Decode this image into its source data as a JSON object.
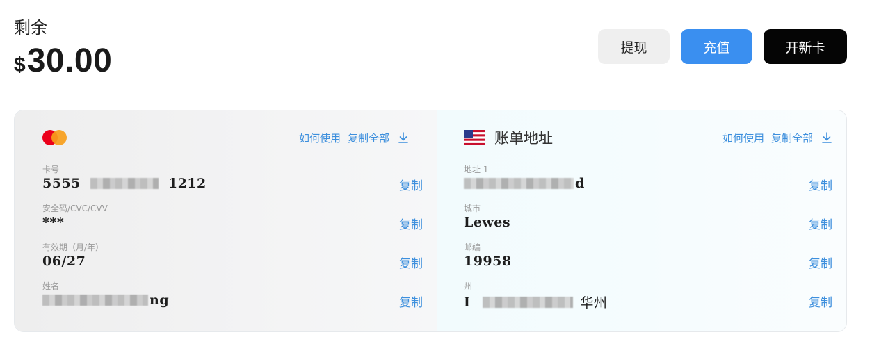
{
  "balance": {
    "label": "剩余",
    "currency": "$",
    "amount": "30.00"
  },
  "actions": {
    "withdraw": "提现",
    "topup": "充值",
    "new_card": "开新卡"
  },
  "card": {
    "brand_icon": "mastercard-logo",
    "how_to_use": "如何使用",
    "copy_all": "复制全部",
    "fields": {
      "number": {
        "label": "卡号",
        "prefix": "5555",
        "suffix": "1212",
        "copy": "复制"
      },
      "cvv": {
        "label": "安全码/CVC/CVV",
        "value": "***",
        "copy": "复制"
      },
      "expiry": {
        "label": "有效期（月/年）",
        "value": "06/27",
        "copy": "复制"
      },
      "name": {
        "label": "姓名",
        "suffix": "ng",
        "copy": "复制"
      }
    }
  },
  "billing": {
    "flag_icon": "us-flag-icon",
    "title": "账单地址",
    "how_to_use": "如何使用",
    "copy_all": "复制全部",
    "fields": {
      "address1": {
        "label": "地址 1",
        "suffix": "d",
        "copy": "复制"
      },
      "city": {
        "label": "城市",
        "value": "Lewes",
        "copy": "复制"
      },
      "zip": {
        "label": "邮编",
        "value": "19958",
        "copy": "复制"
      },
      "state": {
        "label": "州",
        "prefix": "I",
        "suffix": "华州",
        "copy": "复制"
      }
    }
  },
  "colors": {
    "accent": "#3a8ff0",
    "link": "#3d8fdd",
    "dark_button": "#050505",
    "mastercard_red": "#eb001b",
    "mastercard_orange": "#f79e1b"
  }
}
